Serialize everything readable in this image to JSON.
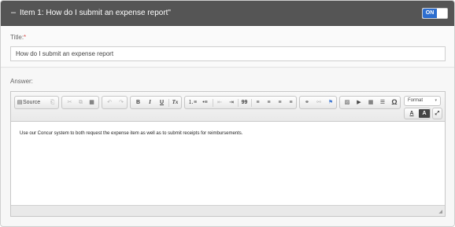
{
  "header": {
    "collapse_symbol": "–",
    "title": "Item 1: How do I submit an expense report\"",
    "toggle_label": "ON"
  },
  "title_field": {
    "label": "Title:",
    "required_mark": "*",
    "value": "How do I submit an expense report"
  },
  "answer_field": {
    "label": "Answer:",
    "content": "Use our Concur system to both request the expense item as well as to submit receipts for reimbursements."
  },
  "toolbar": {
    "source_label": "Source",
    "format_label": "Format",
    "format_arrow": "▾",
    "buttons": {
      "source_icon": "▤",
      "template": "⎗",
      "cut": "✂",
      "copy": "⧉",
      "paste": "▦",
      "undo": "↶",
      "redo": "↷",
      "bold": "B",
      "italic": "I",
      "underline": "U",
      "remove_format": "Tx",
      "numbered_list": "⒈≡",
      "bulleted_list": "•≡",
      "outdent": "⇤",
      "indent": "⇥",
      "blockquote": "99",
      "align_left": "≡",
      "align_center": "≡",
      "align_right": "≡",
      "justify": "≡",
      "link": "⚭",
      "unlink": "⚯",
      "anchor": "⚑",
      "image": "▨",
      "video": "▶",
      "table": "▦",
      "horizontal_rule": "☰",
      "special_char": "Ω",
      "text_color": "A",
      "bg_color": "A",
      "maximize": "⤢"
    }
  },
  "colors": {
    "header_bg": "#555555",
    "toggle_on": "#2d6ecf",
    "required": "#d9534f"
  },
  "icons": {
    "resize": "◢"
  }
}
